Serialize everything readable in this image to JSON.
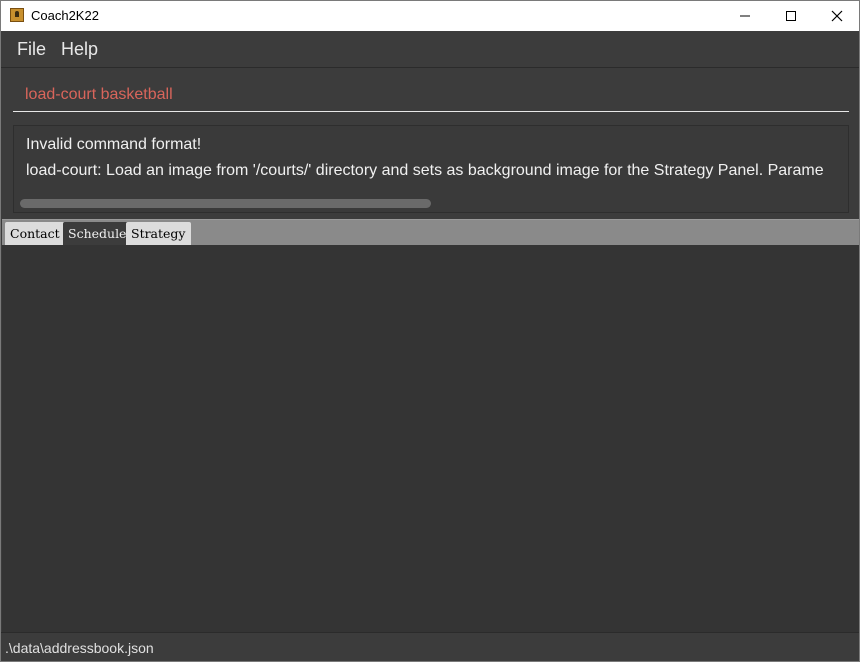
{
  "window": {
    "title": "Coach2K22"
  },
  "menu": {
    "file_label": "File",
    "help_label": "Help"
  },
  "command": {
    "value": "load-court basketball"
  },
  "result": {
    "line1": "Invalid command format!",
    "line2": "load-court: Load an image from '/courts/' directory and sets as background image for the Strategy Panel. Parame"
  },
  "tabs": [
    {
      "label": "Contact",
      "selected": false
    },
    {
      "label": "Schedule",
      "selected": true
    },
    {
      "label": "Strategy",
      "selected": false
    }
  ],
  "status": {
    "file_path": ".\\data\\addressbook.json"
  },
  "colors": {
    "background": "#3c3c3c",
    "command_text": "#d9655b",
    "text": "#f0f0f0"
  },
  "icons": {
    "app": "app-icon",
    "minimize": "minimize-icon",
    "maximize": "maximize-icon",
    "close": "close-icon"
  }
}
